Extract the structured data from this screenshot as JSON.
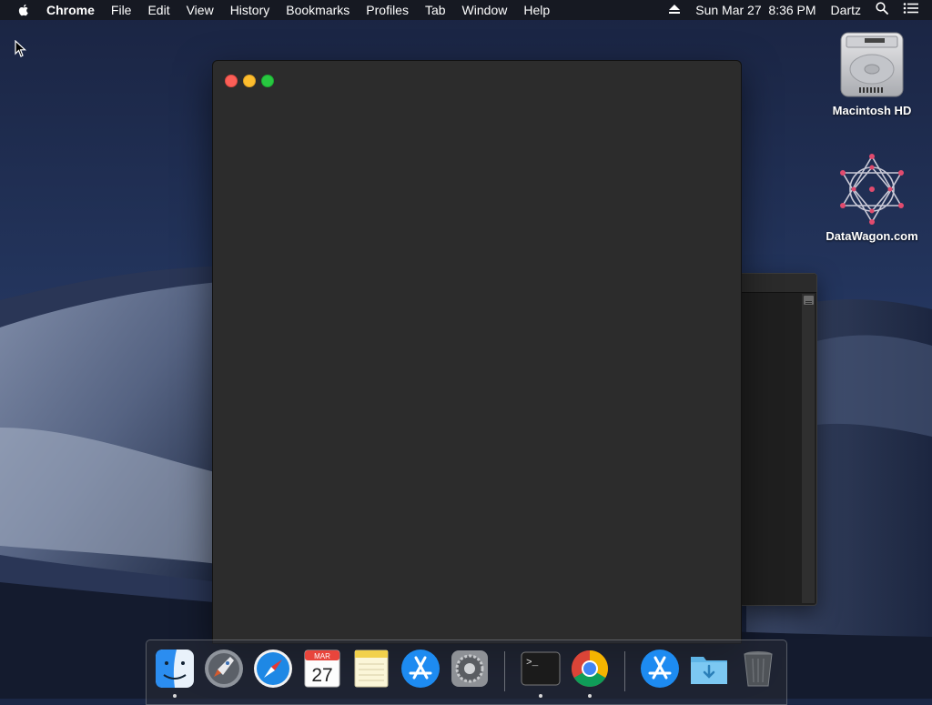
{
  "menubar": {
    "app_name": "Chrome",
    "items": [
      "File",
      "Edit",
      "View",
      "History",
      "Bookmarks",
      "Profiles",
      "Tab",
      "Window",
      "Help"
    ],
    "status": {
      "datetime": "Sun Mar 27  8:36 PM",
      "user": "Dartz",
      "icons": [
        "eject-icon",
        "spotlight-search-icon",
        "notification-center-icon"
      ]
    }
  },
  "desktop": {
    "icons": [
      {
        "label": "Macintosh HD",
        "icon": "hard-drive-icon"
      },
      {
        "label": "DataWagon.com",
        "icon": "datawagon-logo-icon"
      }
    ]
  },
  "windows": {
    "front": {
      "traffic_lights": [
        "close",
        "minimize",
        "zoom"
      ]
    },
    "back": {}
  },
  "dock": {
    "apps": [
      {
        "name": "Finder",
        "icon": "finder-icon",
        "running": true
      },
      {
        "name": "Launchpad",
        "icon": "launchpad-icon",
        "running": false
      },
      {
        "name": "Safari",
        "icon": "safari-icon",
        "running": false
      },
      {
        "name": "Calendar",
        "icon": "calendar-icon",
        "running": false,
        "month": "MAR",
        "day": "27"
      },
      {
        "name": "Notes",
        "icon": "notes-icon",
        "running": false
      },
      {
        "name": "App Store",
        "icon": "app-store-icon",
        "running": false
      },
      {
        "name": "System Preferences",
        "icon": "system-preferences-icon",
        "running": false
      },
      {
        "name": "Terminal",
        "icon": "terminal-icon",
        "running": true,
        "prompt": ">_"
      },
      {
        "name": "Google Chrome",
        "icon": "chrome-icon",
        "running": true
      },
      {
        "name": "App Store Downloads",
        "icon": "app-store-folder-icon",
        "running": false
      },
      {
        "name": "Downloads",
        "icon": "downloads-folder-icon",
        "running": false
      },
      {
        "name": "Trash",
        "icon": "trash-icon",
        "running": false
      }
    ]
  },
  "colors": {
    "close": "#fc5f57",
    "minimize": "#fdbd2e",
    "zoom": "#28c840",
    "window_bg": "#2c2c2c"
  }
}
